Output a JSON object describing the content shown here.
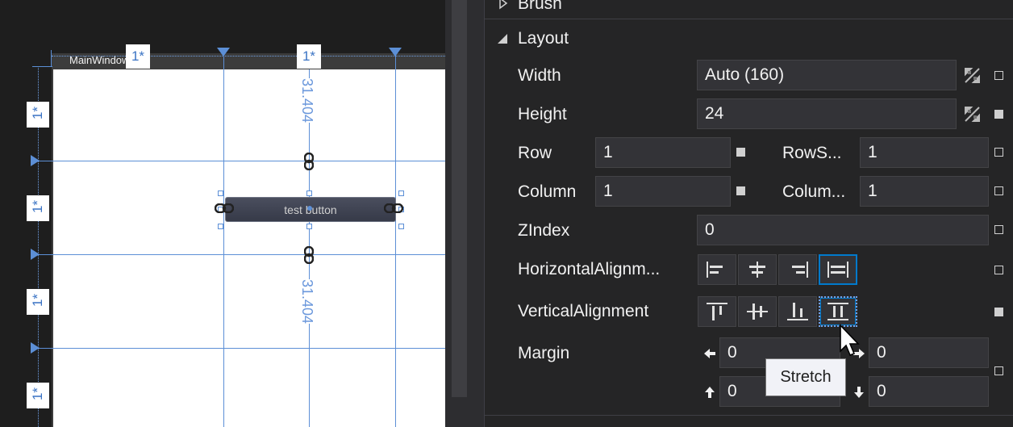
{
  "designer": {
    "window_title": "MainWindow",
    "column_labels": [
      "1*",
      "1*"
    ],
    "row_labels": [
      "1*",
      "1*",
      "1*",
      "1*"
    ],
    "top_distance": "31.404",
    "bottom_distance": "31.404",
    "button_text": "test button"
  },
  "properties": {
    "brush_section": "Brush",
    "layout_section": "Layout",
    "width": {
      "label": "Width",
      "value": "Auto (160)"
    },
    "height": {
      "label": "Height",
      "value": "24"
    },
    "row": {
      "label": "Row",
      "value": "1"
    },
    "rowspan": {
      "label": "RowS...",
      "value": "1"
    },
    "column": {
      "label": "Column",
      "value": "1"
    },
    "columnspan": {
      "label": "Colum...",
      "value": "1"
    },
    "zindex": {
      "label": "ZIndex",
      "value": "0"
    },
    "horizontal_alignment": {
      "label": "HorizontalAlignm...",
      "selected": "Stretch"
    },
    "vertical_alignment": {
      "label": "VerticalAlignment",
      "selected": "Stretch"
    },
    "margin": {
      "label": "Margin",
      "left": "0",
      "right": "0",
      "top": "0",
      "bottom": "0"
    },
    "tooltip": "Stretch"
  },
  "colors": {
    "accent": "#007acc",
    "guide": "#5c8fd6",
    "panel_bg": "#252526",
    "field_bg": "#333337"
  }
}
